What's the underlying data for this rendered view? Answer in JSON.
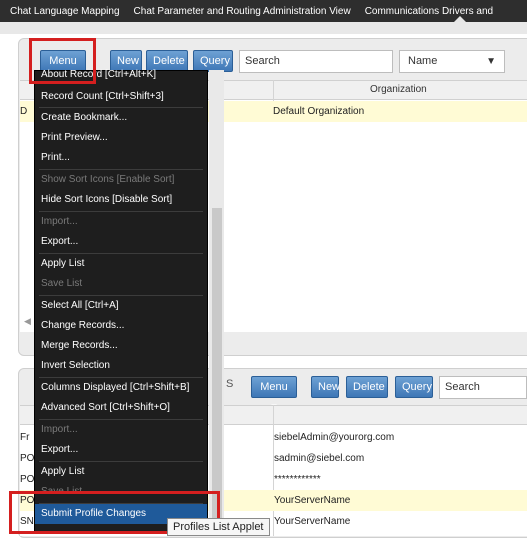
{
  "screen_tabs": [
    "Chat Language Mapping",
    "Chat Parameter and Routing Administration View",
    "Communications Drivers and"
  ],
  "top_applet": {
    "menu_label": "Menu",
    "new_label": "New",
    "delete_label": "Delete",
    "query_label": "Query",
    "search_placeholder": "Search",
    "field_select": "Name",
    "column_organization": "Organization",
    "row_left_cell": "D",
    "row_organization": "Default Organization"
  },
  "bottom_applet": {
    "menu_label": "Menu",
    "new_label": "New",
    "delete_label": "Delete",
    "query_label": "Query",
    "search_placeholder": "Search",
    "clip_letter": "S",
    "rows": [
      {
        "left": "Fr",
        "value": "siebelAdmin@yourorg.com"
      },
      {
        "left": "PO",
        "value": "sadmin@siebel.com"
      },
      {
        "left": "PO",
        "value": "************"
      },
      {
        "left": "PO",
        "value": "YourServerName"
      },
      {
        "left": "SN",
        "value": "YourServerName"
      }
    ]
  },
  "applet_menu": {
    "items": [
      {
        "label": "About Record [Ctrl+Alt+K]",
        "disabled": false
      },
      {
        "label": "Record Count [Ctrl+Shift+3]",
        "disabled": false
      },
      {
        "label": "Create Bookmark...",
        "disabled": false
      },
      {
        "label": "Print Preview...",
        "disabled": false
      },
      {
        "label": "Print...",
        "disabled": false
      },
      {
        "label": "Show Sort Icons [Enable Sort]",
        "disabled": true
      },
      {
        "label": "Hide Sort Icons [Disable Sort]",
        "disabled": false
      },
      {
        "label": "Import...",
        "disabled": true
      },
      {
        "label": "Export...",
        "disabled": false
      },
      {
        "label": "Apply List",
        "disabled": false
      },
      {
        "label": "Save List",
        "disabled": true
      },
      {
        "label": "Select All [Ctrl+A]",
        "disabled": false
      },
      {
        "label": "Change Records...",
        "disabled": false
      },
      {
        "label": "Merge Records...",
        "disabled": false
      },
      {
        "label": "Invert Selection",
        "disabled": false
      },
      {
        "label": "Columns Displayed [Ctrl+Shift+B]",
        "disabled": false
      },
      {
        "label": "Advanced Sort [Ctrl+Shift+O]",
        "disabled": false
      },
      {
        "label": "Import...",
        "disabled": true
      },
      {
        "label": "Export...",
        "disabled": false
      },
      {
        "label": "Apply List",
        "disabled": false
      },
      {
        "label": "Save List",
        "disabled": true
      },
      {
        "label": "Submit Profile Changes",
        "disabled": false,
        "highlighted": true
      }
    ]
  },
  "tooltip": "Profiles List Applet",
  "colors": {
    "tab_bar": "#2e2e2e",
    "button_blue": "#3e77b6",
    "menu_bg": "#1e1e1e",
    "menu_highlight": "#1f5a9a",
    "selected_row": "#fffbd5",
    "annotation_red": "#d41f1f"
  }
}
